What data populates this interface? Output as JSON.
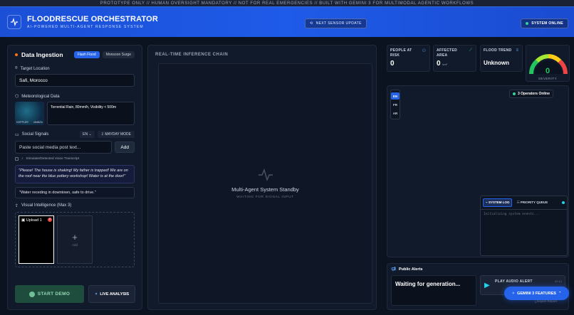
{
  "banner": "PROTOTYPE ONLY // HUMAN OVERSIGHT MANDATORY // NOT FOR REAL EMERGENCIES // BUILT WITH GEMINI 3 FOR MULTIMODAL AGENTIC WORKFLOWS",
  "header": {
    "title": "FLOODRESCUE ORCHESTRATOR",
    "subtitle": "AI-POWERED MULTI-AGENT RESPONSE SYSTEM",
    "sensor_button": "NEXT SENSOR UPDATE",
    "status": "SYSTEM ONLINE"
  },
  "ingestion": {
    "title": "Data Ingestion",
    "modes": [
      "Flash Flood",
      "Monsoon Surge"
    ],
    "target_label": "Target Location",
    "target_value": "Safi, Morocco",
    "met_label": "Meteorological Data",
    "radar_left": "DOPPLER",
    "radar_right": "45dBZ/h",
    "met_value": "Torrential Rain, 80mm/h, Visibility < 500m",
    "social_label": "Social Signals",
    "lang_select": "EN",
    "mayday": "MAYDAY MODE",
    "social_placeholder": "Paste social media post text...",
    "add_label": "Add",
    "voice_label": "Simulate/Detected Voice Transcript",
    "posts": [
      "\"Please! The house is shaking! My father is trapped! We are on the roof near the blue pottery workshop! Water is at the door!\"",
      "\"Water receding in downtown, safe to drive.\""
    ],
    "visual_label": "Visual Intelligence (Max 3)",
    "upload_label": "Upload 1",
    "add_tile": "Add",
    "start_demo": "START DEMO",
    "live_analysis": "LIVE ANALYSIS"
  },
  "inference": {
    "title": "REAL-TIME INFERENCE CHAIN",
    "status": "Multi-Agent System Standby",
    "substatus": "WAITING FOR SIGNAL INPUT"
  },
  "stats": {
    "people_label": "PEOPLE AT RISK",
    "people_value": "0",
    "area_label": "AFFECTED AREA",
    "area_value": "0",
    "area_unit": "km²",
    "trend_label": "FLOOD TREND",
    "trend_value": "Unknown",
    "severity_value": "0",
    "severity_label": "SEVERITY"
  },
  "map": {
    "languages": [
      "EN",
      "FR",
      "AR"
    ],
    "operators": "3 Operators Online",
    "log_tabs": [
      "SYSTEM LOG",
      "PRIORITY QUEUE"
    ],
    "log_text": "Initializing system events..."
  },
  "alerts": {
    "title": "Public Alerts",
    "status": "Waiting for generation...",
    "audio_label": "PLAY AUDIO ALERT",
    "audio_time": "00:12"
  },
  "gemini": "GEMINI 3 FEATURES",
  "export": "Export Report",
  "colors": {
    "accent": "#2563eb",
    "online": "#34d399",
    "alert": "#ef4444"
  }
}
